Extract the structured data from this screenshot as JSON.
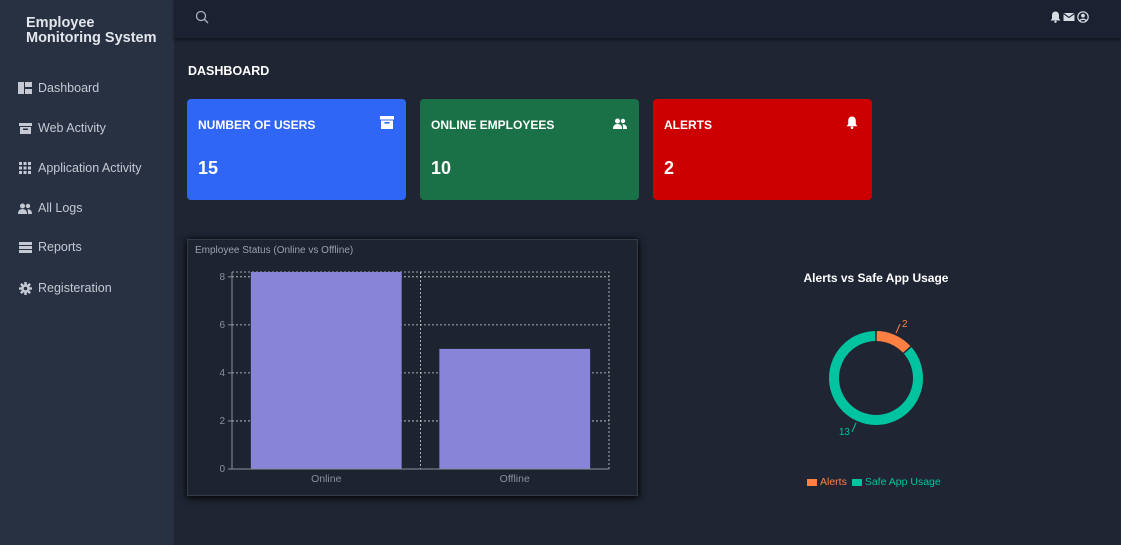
{
  "app": {
    "title": "Employee Monitoring System"
  },
  "sidebar": {
    "items": [
      {
        "label": "Dashboard",
        "icon": "dashboard-icon"
      },
      {
        "label": "Web Activity",
        "icon": "archive-icon"
      },
      {
        "label": "Application Activity",
        "icon": "grid-icon"
      },
      {
        "label": "All Logs",
        "icon": "users-icon"
      },
      {
        "label": "Reports",
        "icon": "list-icon"
      },
      {
        "label": "Registeration",
        "icon": "gear-icon"
      }
    ]
  },
  "topbar": {
    "icons": [
      "search-icon",
      "bell-icon",
      "mail-icon",
      "user-circle-icon"
    ]
  },
  "page": {
    "title": "DASHBOARD"
  },
  "cards": [
    {
      "title": "NUMBER OF USERS",
      "value": "15",
      "icon": "archive-icon",
      "color": "#2f66f5"
    },
    {
      "title": "ONLINE EMPLOYEES",
      "value": "10",
      "icon": "users-icon",
      "color": "#1a7147"
    },
    {
      "title": "ALERTS",
      "value": "2",
      "icon": "bell-icon",
      "color": "#cc0000"
    }
  ],
  "chart_data": [
    {
      "type": "bar",
      "title": "Employee Status (Online vs Offline)",
      "categories": [
        "Online",
        "Offline"
      ],
      "values": [
        8.2,
        5
      ],
      "ylim": [
        0,
        8.2
      ],
      "yticks": [
        "0",
        "2",
        "4",
        "6",
        "8"
      ],
      "grid": true,
      "color": "#8884d8"
    },
    {
      "type": "pie",
      "title": "Alerts vs Safe App Usage",
      "labels": [
        "Alerts",
        "Safe App Usage"
      ],
      "values": [
        2,
        13
      ],
      "colors": [
        "#ff8042",
        "#00c49f"
      ],
      "legend": "bottom"
    }
  ]
}
